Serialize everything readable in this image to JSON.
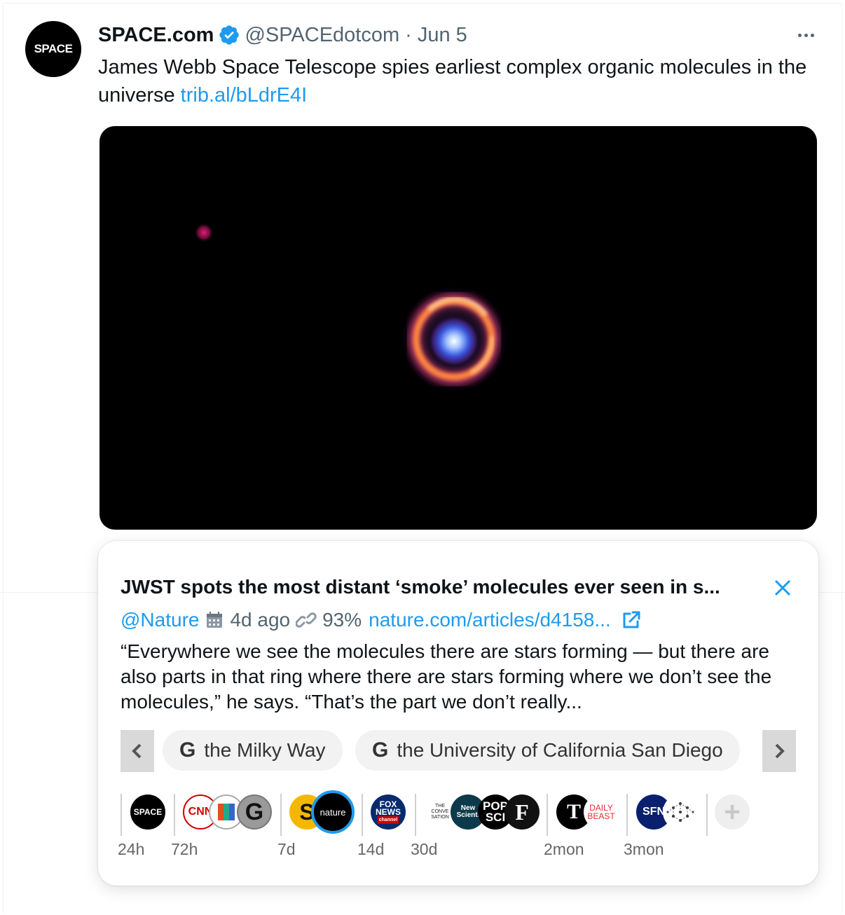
{
  "tweet": {
    "avatar_text": "SPACE",
    "display_name": "SPACE.com",
    "handle": "@SPACEdotcom",
    "separator": "·",
    "date": "Jun 5",
    "text": "James Webb Space Telescope spies earliest complex organic molecules in the universe ",
    "link": "trib.al/bLdrE4I",
    "more_icon": "more-horizontal-icon",
    "verified_icon": "verified-badge-icon",
    "colors": {
      "link": "#1d9bf0",
      "secondary": "#536471"
    }
  },
  "card": {
    "title": "JWST spots the most distant ‘smoke’ molecules ever seen in s...",
    "source": "@Nature",
    "age": "4d ago",
    "score": "93%",
    "url": "nature.com/articles/d4158...",
    "excerpt": "“Everywhere we see the molecules there are stars forming — but there are also parts in that ring where there are stars forming where we don’t see the molecules,” he says. “That’s the part we don’t really...",
    "topics": [
      "the Milky Way",
      "the University of California San Diego"
    ],
    "topic_prefix": "G"
  },
  "timeline": {
    "labels": [
      "24h",
      "72h",
      "7d",
      "14d",
      "30d",
      "2mon",
      "3mon"
    ],
    "logos": {
      "space": "SPACE",
      "cnn": "CNN",
      "g": "G",
      "s": "S",
      "nature": "nature",
      "fox_top": "FOX",
      "fox_mid": "NEWS",
      "fox_bottom": "channel",
      "conversation_top": "THE",
      "conversation_mid": "CONVE",
      "conversation_bottom": "SATION",
      "newsci_top": "New",
      "newsci_bottom": "Scienti",
      "popsci_top": "POP",
      "popsci_bottom": "SCI",
      "f": "F",
      "nyt": "T",
      "dailybeast_top": "DAILY",
      "dailybeast_bottom": "BEAST",
      "sfn": "SFN",
      "plus": "+"
    }
  }
}
